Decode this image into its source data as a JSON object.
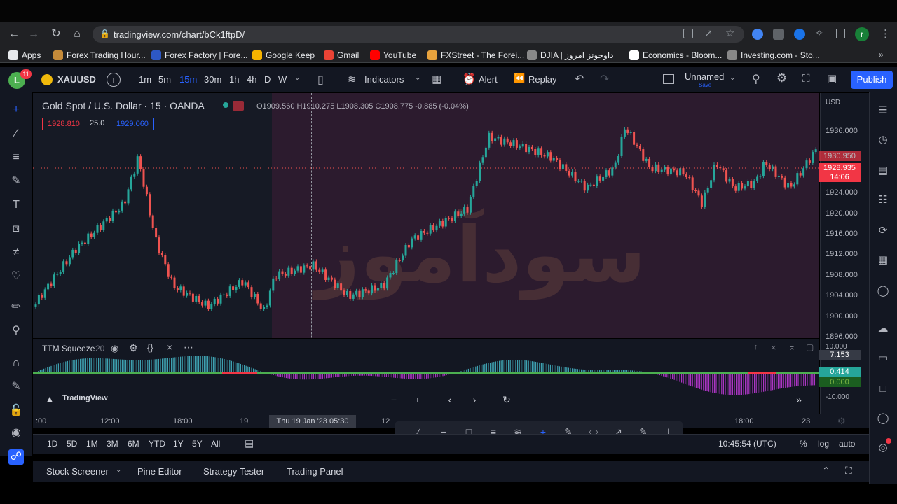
{
  "browser": {
    "url": "tradingview.com/chart/bCk1ftpD/",
    "bookmarks": [
      {
        "label": "Apps",
        "color": "#e8eaed"
      },
      {
        "label": "Forex Trading Hour...",
        "color": "#c58b3a"
      },
      {
        "label": "Forex Factory | Fore...",
        "color": "#2d58c5"
      },
      {
        "label": "Google Keep",
        "color": "#f6b400"
      },
      {
        "label": "Gmail",
        "color": "#ea4335"
      },
      {
        "label": "YouTube",
        "color": "#ff0000"
      },
      {
        "label": "FXStreet - The Forei...",
        "color": "#e8a33d"
      },
      {
        "label": "DJIA | داوجونز امروز",
        "color": "#888888"
      },
      {
        "label": "Economics - Bloom...",
        "color": "#ffffff"
      },
      {
        "label": "Investing.com - Sto...",
        "color": "#888888"
      }
    ],
    "profile_initial": "r"
  },
  "toolbar": {
    "user_initial": "L",
    "notification_count": "11",
    "symbol": "XAUUSD",
    "intervals": [
      "1m",
      "5m",
      "15m",
      "30m",
      "1h",
      "4h",
      "D",
      "W"
    ],
    "active_interval": "15m",
    "indicators_label": "Indicators",
    "alert_label": "Alert",
    "replay_label": "Replay",
    "layout_name": "Unnamed",
    "layout_sub": "Save",
    "publish_label": "Publish"
  },
  "legend": {
    "title": "Gold Spot / U.S. Dollar · 15 · OANDA",
    "ohlc": "O1909.560  H1910.275  L1908.305  C1908.775  -0.885 (-0.04%)",
    "bid": "1928.810",
    "spread": "25.0",
    "ask": "1929.060"
  },
  "price_scale": {
    "currency": "USD",
    "ticks": [
      "1936.000",
      "1932.000",
      "1928.000",
      "1924.000",
      "1920.000",
      "1916.000",
      "1912.000",
      "1908.000",
      "1904.000",
      "1900.000",
      "1896.000"
    ],
    "last_price": "1928.935",
    "countdown": "14:06",
    "ask_price": "1930.950"
  },
  "indicator": {
    "name": "TTM Squeeze",
    "param": "20",
    "value_top": "7.153",
    "value_mid": "0.414",
    "value_zero": "0.000",
    "scale_top": "10.000",
    "scale_bottom": "-10.000"
  },
  "time_scale": {
    "ticks": [
      ":00",
      "12:00",
      "18:00",
      "19",
      "12",
      "18:00",
      "23"
    ],
    "crosshair_label": "Thu 19 Jan '23  05:30"
  },
  "watermark": "سودآموز",
  "branding": "TradingView",
  "bottom": {
    "ranges": [
      "1D",
      "5D",
      "1M",
      "3M",
      "6M",
      "YTD",
      "1Y",
      "5Y",
      "All"
    ],
    "clock": "10:45:54 (UTC)",
    "percent": "%",
    "log": "log",
    "auto": "auto"
  },
  "panels": [
    "Stock Screener",
    "Pine Editor",
    "Strategy Tester",
    "Trading Panel"
  ],
  "colors": {
    "up": "#26a69a",
    "down": "#ef5350",
    "accent": "#2962ff",
    "session": "#2d1b2e"
  }
}
